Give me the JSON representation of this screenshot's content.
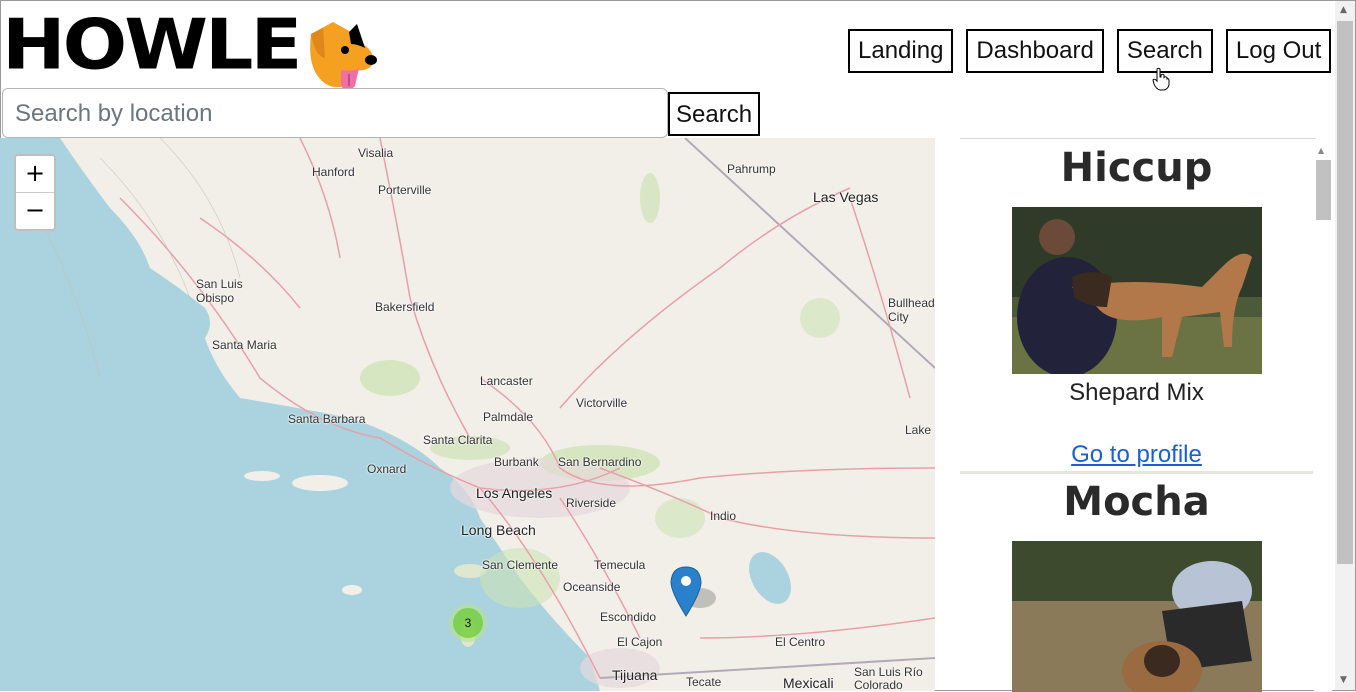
{
  "brand": {
    "logo_text": "HOWLE"
  },
  "nav": {
    "items": [
      {
        "label": "Landing"
      },
      {
        "label": "Dashboard"
      },
      {
        "label": "Search"
      },
      {
        "label": "Log Out"
      }
    ]
  },
  "search": {
    "placeholder": "Search by location",
    "button_label": "Search"
  },
  "map": {
    "zoom_in": "+",
    "zoom_out": "−",
    "cluster_count": "3",
    "places": [
      "Visalia",
      "Hanford",
      "Porterville",
      "Pahrump",
      "Las Vegas",
      "San Luis Obispo",
      "Bakersfield",
      "Bullhead City",
      "Santa Maria",
      "Lancaster",
      "Victorville",
      "Palmdale",
      "Santa Barbara",
      "Santa Clarita",
      "Lake",
      "Oxnard",
      "Burbank",
      "San Bernardino",
      "Los Angeles",
      "Riverside",
      "Long Beach",
      "Indio",
      "San Clemente",
      "Temecula",
      "Oceanside",
      "Escondido",
      "El Cajon",
      "El Centro",
      "Tijuana",
      "Tecate",
      "Mexicali",
      "San Luis Río Colorado"
    ]
  },
  "dogs": [
    {
      "name": "Hiccup",
      "breed": "Shepard Mix",
      "link_label": "Go to profile"
    },
    {
      "name": "Mocha"
    }
  ],
  "colors": {
    "link": "#1a5fd6",
    "cluster": "#6ecc39",
    "marker": "#2a81cb",
    "water": "#aad3df",
    "land": "#f2efe9"
  }
}
